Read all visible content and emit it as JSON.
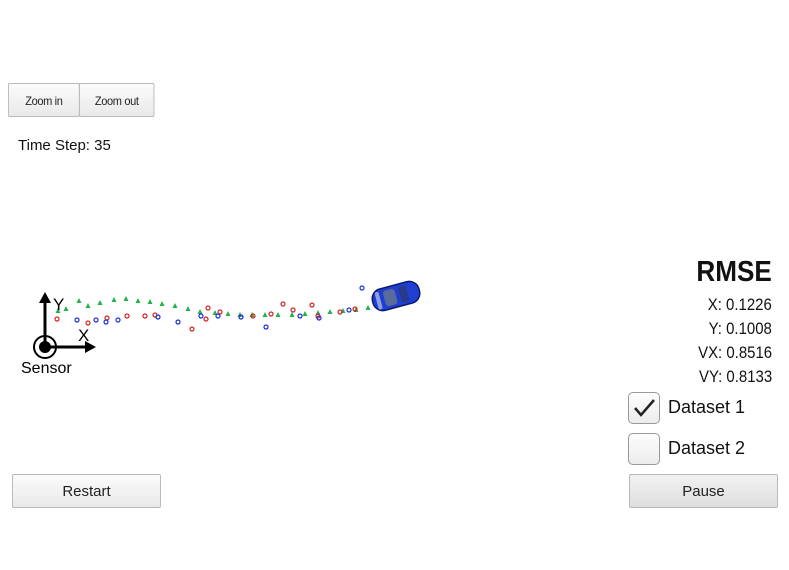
{
  "toolbar": {
    "zoom_in_label": "Zoom in",
    "zoom_out_label": "Zoom out"
  },
  "status": {
    "time_step": "Time Step: 35"
  },
  "sensor": {
    "label": "Sensor",
    "x_axis_label": "X",
    "y_axis_label": "Y"
  },
  "rmse": {
    "title": "RMSE",
    "x": "X: 0.1226",
    "y": "Y: 0.1008",
    "vx": "VX: 0.8516",
    "vy": "VY: 0.8133"
  },
  "datasets": [
    {
      "label": "Dataset 1",
      "checked": true
    },
    {
      "label": "Dataset 2",
      "checked": false
    }
  ],
  "controls": {
    "restart_label": "Restart",
    "pause_label": "Pause"
  },
  "colors": {
    "estimate_marker": "#22b14c",
    "lidar_marker": "#d22020",
    "radar_marker": "#1a2bd6",
    "car_body": "#1f3fd0"
  },
  "icons": {
    "sensor": "sensor-icon",
    "car": "car-icon",
    "checkmark": "checkmark-icon"
  }
}
